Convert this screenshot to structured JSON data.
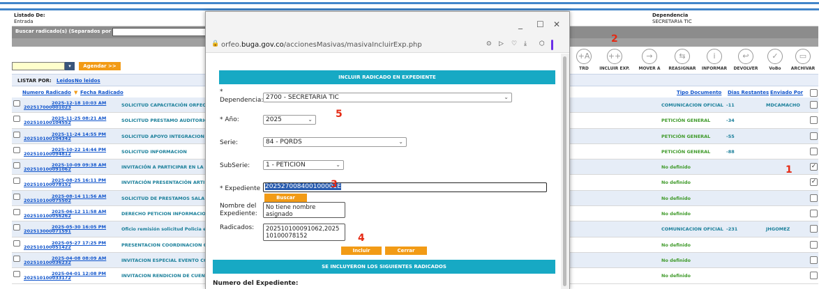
{
  "header": {
    "listado_label": "Listado De:",
    "listado_value": "Entrada",
    "dependencia_label": "Dependencia",
    "dependencia_value": "SECRETARIA TIC"
  },
  "search": {
    "label": "Buscar radicado(s) (Separados por coma)",
    "value": ""
  },
  "agendar": {
    "value": "",
    "button": "Agendar >>"
  },
  "listar": {
    "label": "LISTAR POR:",
    "leidos": "Leidos",
    "no_leidos": "No leidos"
  },
  "toolbar": [
    {
      "icon": "plus-a-icon",
      "glyph": "+A",
      "label": "TRD"
    },
    {
      "icon": "plus-circle-icon",
      "glyph": "++",
      "label": "INCLUIR EXP."
    },
    {
      "icon": "arrow-right-icon",
      "glyph": "→",
      "label": "MOVER A"
    },
    {
      "icon": "reassign-icon",
      "glyph": "⇆",
      "label": "REASIGNAR"
    },
    {
      "icon": "info-icon",
      "glyph": "i",
      "label": "INFORMAR"
    },
    {
      "icon": "return-icon",
      "glyph": "↩",
      "label": "DEVOLVER"
    },
    {
      "icon": "check-icon",
      "glyph": "✓",
      "label": "VoBo"
    },
    {
      "icon": "archive-icon",
      "glyph": "▭",
      "label": "ARCHIVAR"
    }
  ],
  "columns": {
    "numero": "Numero Radicado",
    "fecha": "Fecha Radicado",
    "tipo": "Tipo Documento",
    "dias": "Dias Restantes",
    "enviado": "Enviado Por"
  },
  "rows": [
    {
      "radicado": "202517000001023",
      "fecha": "2025-12-18 10:03 AM",
      "asunto": "SOLICITUD CAPACITACIÓN ORFEO",
      "tipo": "COMUNICACION OFICIAL",
      "dias": "-11",
      "enviado": "MDCAMACHO",
      "checked": false
    },
    {
      "radicado": "202510100104552",
      "fecha": "2025-11-25 08:21 AM",
      "asunto": "SOLICITUD PRESTAMO AUDITORIO",
      "tipo": "PETICIÓN GENERAL",
      "dias": "-34",
      "enviado": "",
      "checked": false
    },
    {
      "radicado": "202510100104342",
      "fecha": "2025-11-24 14:55 PM",
      "asunto": "SOLICITUD APOYO INTEGRACION F",
      "tipo": "PETICIÓN GENERAL",
      "dias": "-55",
      "enviado": "",
      "checked": false
    },
    {
      "radicado": "202510100094812",
      "fecha": "2025-10-22 14:44 PM",
      "asunto": "SOLICITUD INFORMACION",
      "tipo": "PETICIÓN GENERAL",
      "dias": "-88",
      "enviado": "",
      "checked": false
    },
    {
      "radicado": "202510100091062",
      "fecha": "2025-10-09 09:38 AM",
      "asunto": "INVITACIÓN A PARTICIPAR EN LA SE",
      "tipo": "No definido",
      "dias": "",
      "enviado": "",
      "checked": true
    },
    {
      "radicado": "202510100078152",
      "fecha": "2025-08-25 16:11 PM",
      "asunto": "INVITACIÓN PRESENTACIÓN ARTIST",
      "tipo": "No definido",
      "dias": "",
      "enviado": "",
      "checked": true
    },
    {
      "radicado": "202510100075502",
      "fecha": "2025-08-14 11:56 AM",
      "asunto": "SOLICITUD DE PRESTAMOS SALA D",
      "tipo": "No definido",
      "dias": "",
      "enviado": "",
      "checked": false
    },
    {
      "radicado": "202510100056262",
      "fecha": "2025-06-12 11:58 AM",
      "asunto": "DERECHO PETICION INFORMACION",
      "tipo": "No definido",
      "dias": "",
      "enviado": "",
      "checked": false
    },
    {
      "radicado": "202513000071591",
      "fecha": "2025-05-30 16:05 PM",
      "asunto": "Oficio remisión solicitud Policia entr",
      "tipo": "COMUNICACION OFICIAL",
      "dias": "-231",
      "enviado": "JHGOMEZ",
      "checked": false
    },
    {
      "radicado": "202510100051422",
      "fecha": "2025-05-27 17:25 PM",
      "asunto": "PRESENTACION COORDINACION CI",
      "tipo": "No definido",
      "dias": "",
      "enviado": "",
      "checked": false
    },
    {
      "radicado": "202510100036232",
      "fecha": "2025-04-08 08:09 AM",
      "asunto": "INVITACION ESPECIAL EVENTO COI",
      "tipo": "No definido",
      "dias": "",
      "enviado": "",
      "checked": false
    },
    {
      "radicado": "202510100033172",
      "fecha": "2025-04-01 12:08 PM",
      "asunto": "INVITACION RENDICION DE CUENTA",
      "tipo": "No definido",
      "dias": "",
      "enviado": "",
      "checked": false
    }
  ],
  "modal": {
    "url_prefix": "orfeo.",
    "url_domain": "buga.gov.co",
    "url_path": "/accionesMasivas/masivaIncluirExp.php",
    "win_min": "_",
    "win_max": "☐",
    "win_close": "✕",
    "title": "INCLUIR RADICADO EN EXPEDIENTE",
    "dependencia_label": "Dependencia:",
    "dependencia_star": "*",
    "dependencia_value": "2700 - SECRETARIA TIC",
    "anio_label": "* Año:",
    "anio_value": "2025",
    "serie_label": "Serie:",
    "serie_value": "84 - PQRDS",
    "subserie_label": "SubSerie:",
    "subserie_value": "1 - PETICION",
    "expediente_label": "* Expediente",
    "expediente_value": "202527008400100001E",
    "buscar": "Buscar",
    "nombre_label": "Nombre del Expediente:",
    "nombre_value": "No tiene nombre asignado",
    "radicados_label": "Radicados:",
    "radicados_value": "202510100091062,202510100078152",
    "incluir": "Incluir",
    "cerrar": "Cerrar",
    "result_title": "SE INCLUYERON LOS SIGUIENTES RADICADOS",
    "numero_exp_label": "Numero del Expediente:"
  },
  "annotations": {
    "m1": "1",
    "m2": "2",
    "m3": "3",
    "m4": "4",
    "m5": "5"
  },
  "colors": {
    "accent_orange": "#f29b16",
    "header_blue": "#17a9c4",
    "annotation_red": "#e52a14"
  }
}
